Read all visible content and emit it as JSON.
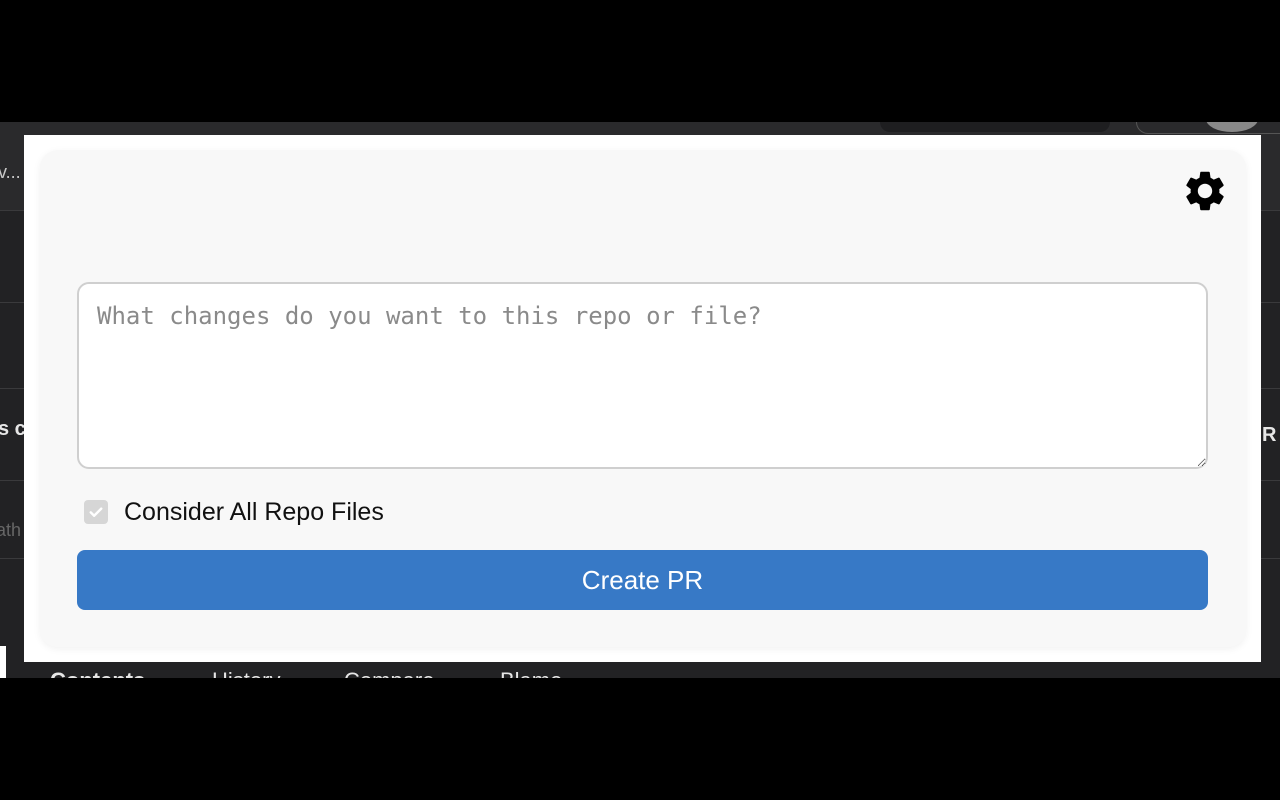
{
  "background": {
    "left_snippets": [
      "v...",
      "s c",
      "ath"
    ],
    "right_snippet": "R",
    "tabs": [
      "Contents",
      "History",
      "Compare",
      "Blame"
    ]
  },
  "popup": {
    "settings_icon": "gear-icon",
    "prompt": {
      "value": "",
      "placeholder": "What changes do you want to this repo or file?"
    },
    "consider_all_files": {
      "label": "Consider All Repo Files",
      "checked": true,
      "disabled": true
    },
    "create_button_label": "Create PR",
    "accent_color": "#3779c6"
  }
}
